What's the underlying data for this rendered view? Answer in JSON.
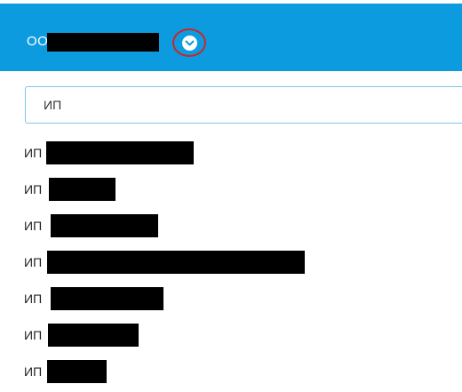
{
  "header": {
    "org_name": "ОО",
    "toggle_icon": "chevron-down-icon",
    "background_color": "#0d9be0",
    "highlight_color": "#c62828"
  },
  "search": {
    "value": "ИП",
    "placeholder": ""
  },
  "results": [
    {
      "prefix": "ИП"
    },
    {
      "prefix": "ИП"
    },
    {
      "prefix": "ИП"
    },
    {
      "prefix": "ИП"
    },
    {
      "prefix": "ИП"
    },
    {
      "prefix": "ИП"
    },
    {
      "prefix": "ИП"
    }
  ]
}
